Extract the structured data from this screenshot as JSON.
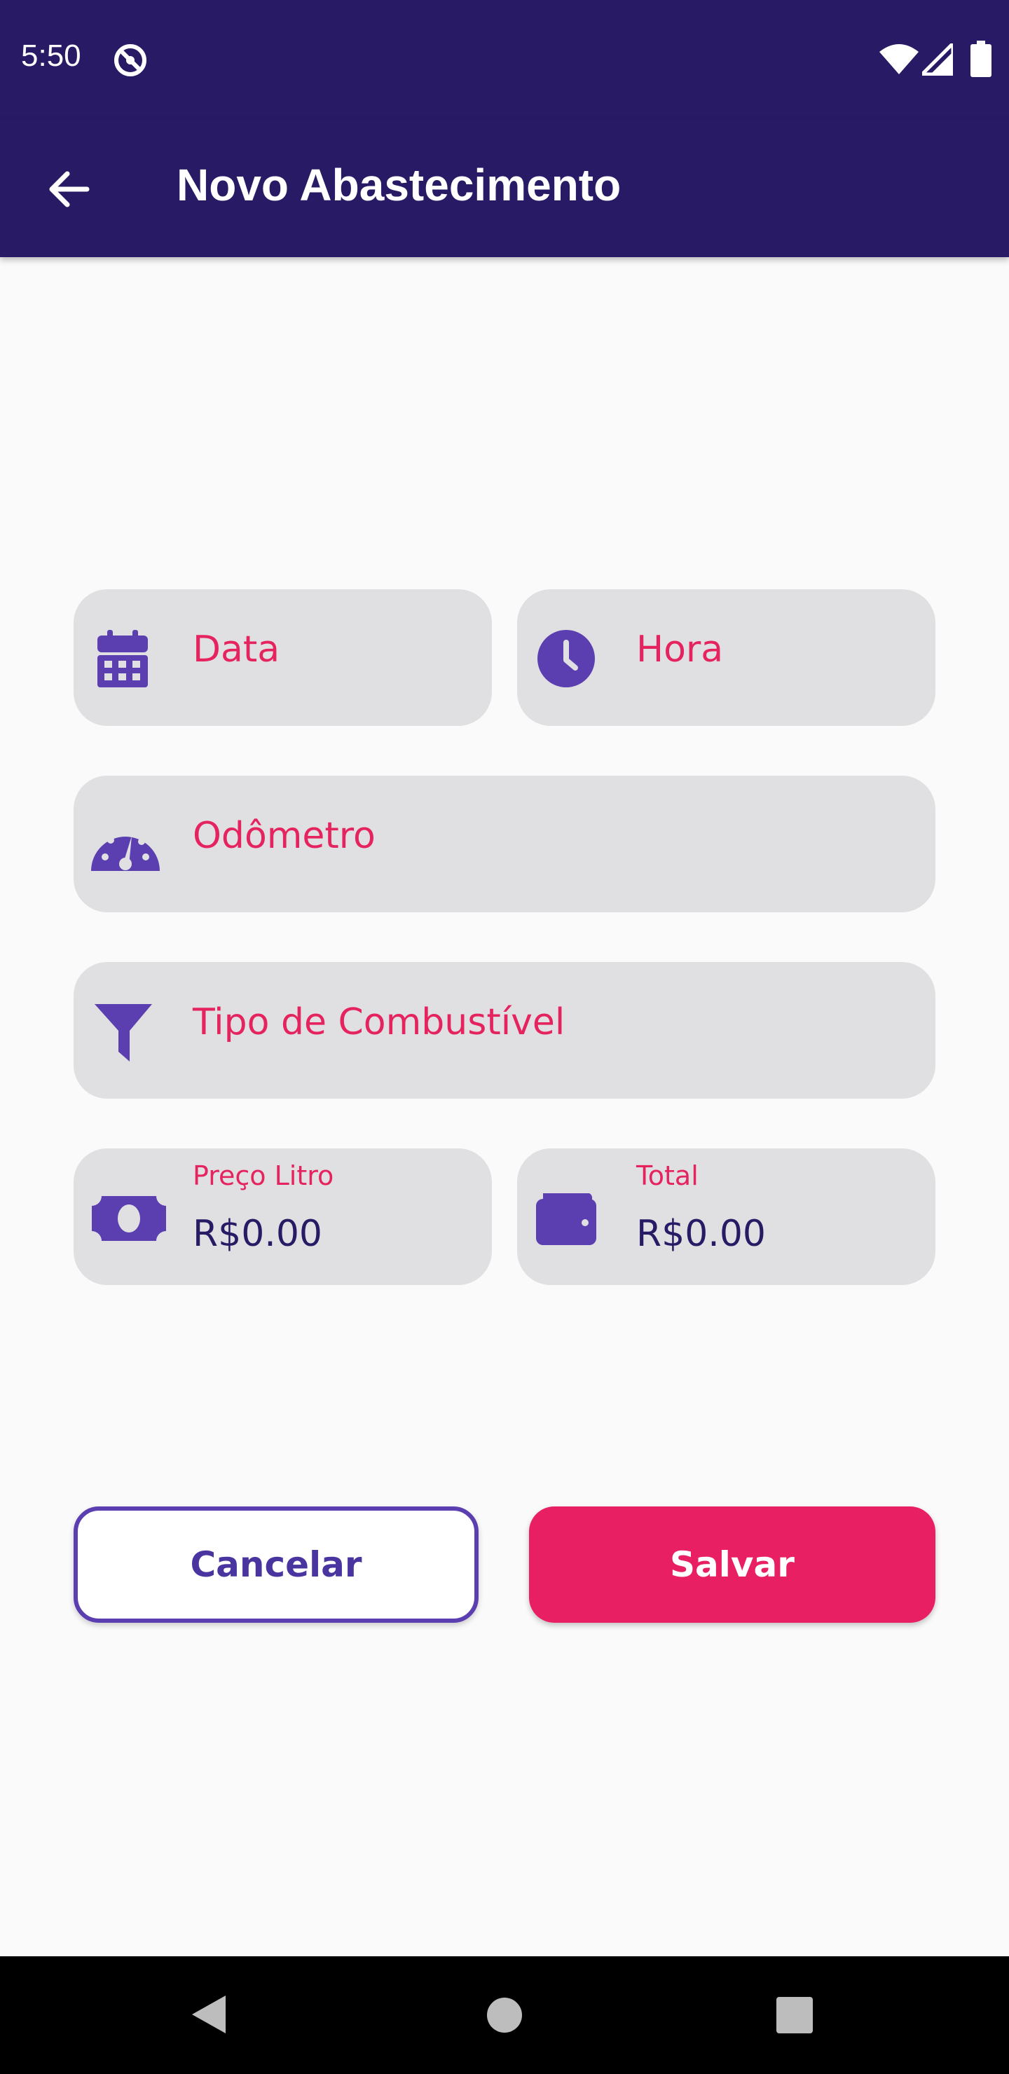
{
  "status_bar": {
    "time": "5:50",
    "icons": [
      "hotspot-icon",
      "wifi-icon",
      "signal-icon",
      "battery-icon"
    ]
  },
  "app_bar": {
    "back_icon": "arrow-back-icon",
    "title": "Novo Abastecimento"
  },
  "form": {
    "date": {
      "icon": "calendar-icon",
      "placeholder": "Data"
    },
    "time": {
      "icon": "clock-icon",
      "placeholder": "Hora"
    },
    "odometer": {
      "icon": "speedometer-icon",
      "placeholder": "Odômetro"
    },
    "fuel_type": {
      "icon": "funnel-icon",
      "placeholder": "Tipo de Combustível"
    },
    "price_per_liter": {
      "icon": "money-bill-icon",
      "label": "Preço Litro",
      "value": "R$0.00"
    },
    "total": {
      "icon": "wallet-icon",
      "label": "Total",
      "value": "R$0.00"
    }
  },
  "actions": {
    "cancel_label": "Cancelar",
    "save_label": "Salvar"
  },
  "nav_bar": {
    "icons": [
      "nav-back-icon",
      "nav-home-icon",
      "nav-recents-icon"
    ]
  },
  "colors": {
    "primary_dark": "#281a64",
    "accent_pink": "#e91f63",
    "icon_purple": "#5b3fb0",
    "field_bg": "#e0e0e2",
    "background": "#fafafa"
  }
}
